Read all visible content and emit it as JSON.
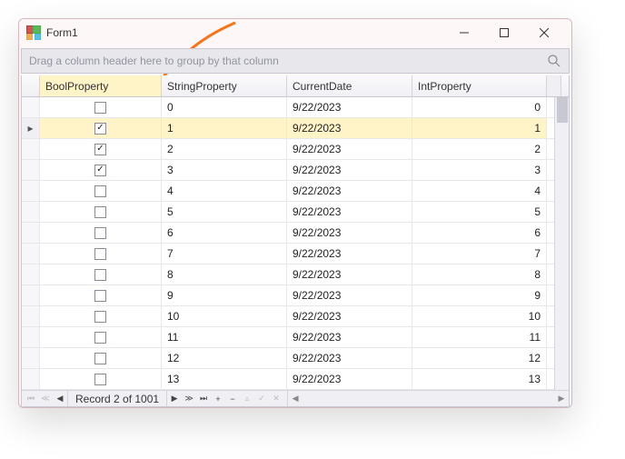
{
  "window": {
    "title": "Form1"
  },
  "groupPanel": {
    "hint": "Drag a column header here to group by that column"
  },
  "columns": {
    "bool": "BoolProperty",
    "string": "StringProperty",
    "date": "CurrentDate",
    "int": "IntProperty"
  },
  "rows": [
    {
      "bool": false,
      "string": "0",
      "date": "9/22/2023",
      "int": "0",
      "selected": false,
      "indicator": ""
    },
    {
      "bool": true,
      "string": "1",
      "date": "9/22/2023",
      "int": "1",
      "selected": true,
      "indicator": "▸"
    },
    {
      "bool": true,
      "string": "2",
      "date": "9/22/2023",
      "int": "2",
      "selected": false,
      "indicator": ""
    },
    {
      "bool": true,
      "string": "3",
      "date": "9/22/2023",
      "int": "3",
      "selected": false,
      "indicator": ""
    },
    {
      "bool": false,
      "string": "4",
      "date": "9/22/2023",
      "int": "4",
      "selected": false,
      "indicator": ""
    },
    {
      "bool": false,
      "string": "5",
      "date": "9/22/2023",
      "int": "5",
      "selected": false,
      "indicator": ""
    },
    {
      "bool": false,
      "string": "6",
      "date": "9/22/2023",
      "int": "6",
      "selected": false,
      "indicator": ""
    },
    {
      "bool": false,
      "string": "7",
      "date": "9/22/2023",
      "int": "7",
      "selected": false,
      "indicator": ""
    },
    {
      "bool": false,
      "string": "8",
      "date": "9/22/2023",
      "int": "8",
      "selected": false,
      "indicator": ""
    },
    {
      "bool": false,
      "string": "9",
      "date": "9/22/2023",
      "int": "9",
      "selected": false,
      "indicator": ""
    },
    {
      "bool": false,
      "string": "10",
      "date": "9/22/2023",
      "int": "10",
      "selected": false,
      "indicator": ""
    },
    {
      "bool": false,
      "string": "11",
      "date": "9/22/2023",
      "int": "11",
      "selected": false,
      "indicator": ""
    },
    {
      "bool": false,
      "string": "12",
      "date": "9/22/2023",
      "int": "12",
      "selected": false,
      "indicator": ""
    },
    {
      "bool": false,
      "string": "13",
      "date": "9/22/2023",
      "int": "13",
      "selected": false,
      "indicator": ""
    }
  ],
  "navigator": {
    "recordText": "Record 2 of 1001",
    "buttons": {
      "first": "⏮",
      "prevPage": "◀◀",
      "prev": "◀",
      "next": "▶",
      "nextPage": "▶▶",
      "last": "⏭",
      "append": "+",
      "remove": "−",
      "edit": "▴",
      "endEdit": "✓",
      "cancel": "✕"
    }
  },
  "annotation": {
    "color": "#f97316"
  }
}
